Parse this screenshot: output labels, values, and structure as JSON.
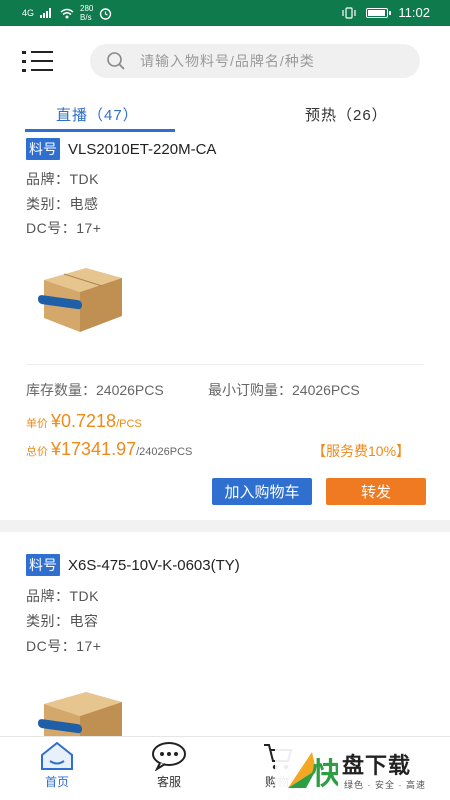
{
  "status_bar": {
    "network": "4G",
    "speed_value": "280",
    "speed_unit": "B/s",
    "time": "11:02",
    "battery_level": 0.85
  },
  "search": {
    "placeholder": "请输入物料号/品牌名/种类"
  },
  "tabs": [
    {
      "label": "直播（47）",
      "active": true
    },
    {
      "label": "预热（26）",
      "active": false
    }
  ],
  "cards": [
    {
      "pn_tag": "料号",
      "part_number": "VLS2010ET-220M-CA",
      "brand": "品牌：TDK",
      "category": "类别：电感",
      "dc": "DC号：17+",
      "stock": "库存数量：24026PCS",
      "min_order": "最小订购量：24026PCS",
      "unit_label": "单价",
      "unit_price": "¥0.7218",
      "unit_suffix": "/PCS",
      "total_label": "总价",
      "total_price": "¥17341.97",
      "total_qty": "/24026PCS",
      "fee": "【服务费10%】",
      "cart_btn": "加入购物车",
      "share_btn": "转发"
    },
    {
      "pn_tag": "料号",
      "part_number": "X6S-475-10V-K-0603(TY)",
      "brand": "品牌：TDK",
      "category": "类别：电容",
      "dc": "DC号：17+"
    }
  ],
  "bottom_nav": [
    {
      "label": "首页",
      "icon": "home-icon",
      "active": true
    },
    {
      "label": "客服",
      "icon": "chat-icon",
      "active": false
    },
    {
      "label": "购物",
      "icon": "cart-icon",
      "active": false
    }
  ],
  "watermark": {
    "logo_char": "快",
    "title": "盘下载",
    "subtitle": "绿色 · 安全 · 高速"
  },
  "colors": {
    "status_bar": "#0f7a4c",
    "accent_blue": "#2f6fcf",
    "price_orange": "#f08a18",
    "share_orange": "#f07a22"
  }
}
